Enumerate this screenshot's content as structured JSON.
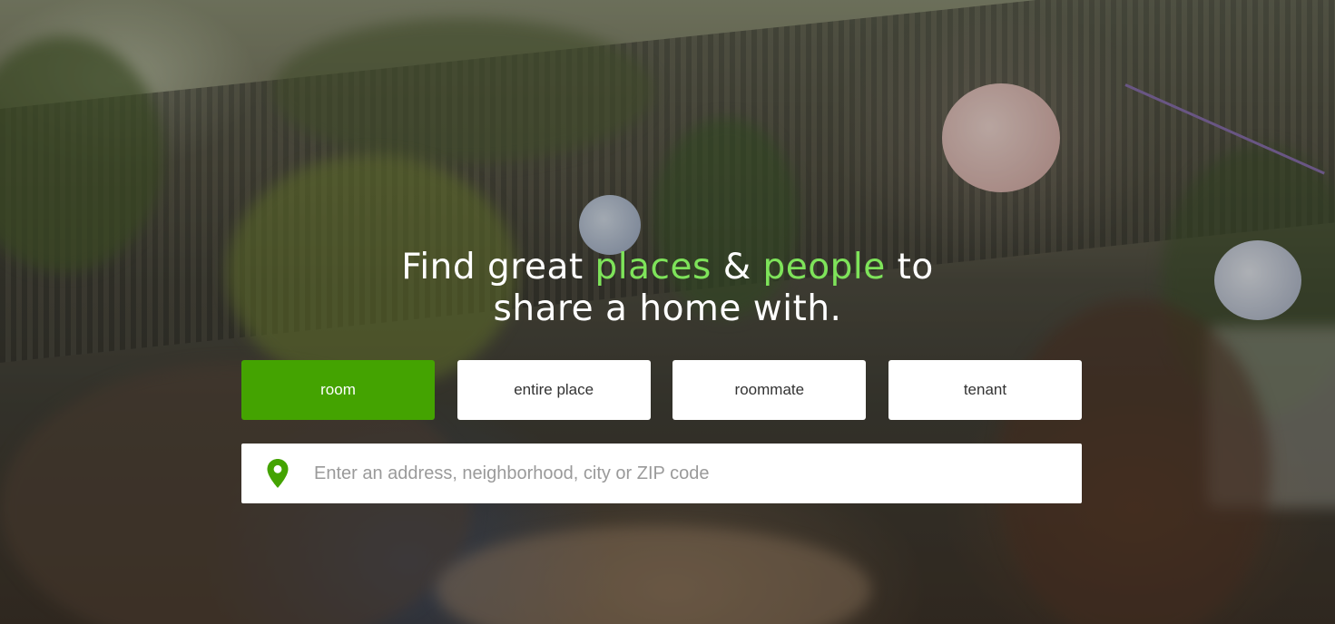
{
  "hero": {
    "headline": {
      "part1": "Find great ",
      "accent1": "places",
      "part2": " & ",
      "accent2": "people",
      "part3": " to",
      "line2": "share a home with."
    },
    "accent_color": "#7ee35a"
  },
  "search_type_tabs": [
    {
      "label": "room",
      "active": true
    },
    {
      "label": "entire place",
      "active": false
    },
    {
      "label": "roommate",
      "active": false
    },
    {
      "label": "tenant",
      "active": false
    }
  ],
  "search": {
    "placeholder": "Enter an address, neighborhood, city or ZIP code",
    "value": "",
    "icon": "location-pin-icon"
  },
  "colors": {
    "active_tab": "#44a301",
    "pin": "#44a301",
    "tab_bg": "#ffffff"
  }
}
